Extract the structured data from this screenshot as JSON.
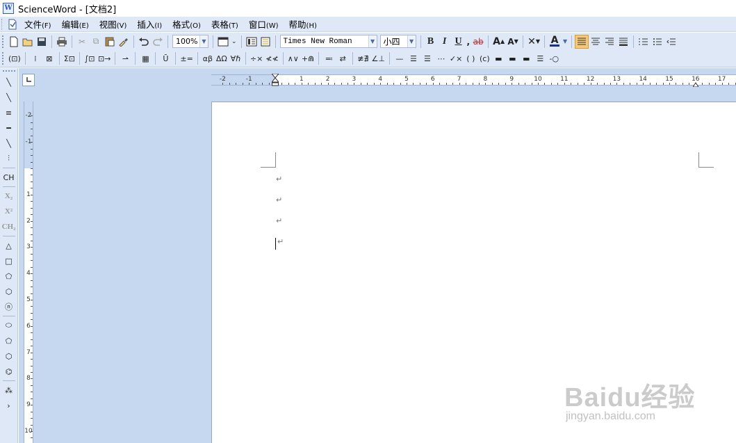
{
  "window": {
    "title": "ScienceWord - [文档2]"
  },
  "menu": [
    {
      "label": "文件",
      "accel": "(F)"
    },
    {
      "label": "编辑",
      "accel": "(E)"
    },
    {
      "label": "视图",
      "accel": "(V)"
    },
    {
      "label": "插入",
      "accel": "(I)"
    },
    {
      "label": "格式",
      "accel": "(O)"
    },
    {
      "label": "表格",
      "accel": "(T)"
    },
    {
      "label": "窗口",
      "accel": "(W)"
    },
    {
      "label": "帮助",
      "accel": "(H)"
    }
  ],
  "toolbar": {
    "zoom": "100%",
    "font_name": "Times New Roman",
    "font_size": "小四",
    "bold": "B",
    "italic": "I",
    "underline": "U",
    "strike": "ab",
    "grow_font": "A",
    "shrink_font": "A",
    "font_color": "A"
  },
  "toolbar2": {
    "items": [
      "(⊡)",
      "⁞",
      "⊠",
      "Σ⊡",
      "∫⊡",
      "⊡→",
      "⇀",
      "▦",
      "Ū",
      "±=",
      "αβ",
      "ΔΩ",
      "∀ℏ",
      "÷×",
      "≮≮",
      "∧∨",
      "+⋒",
      "≕",
      "⇄",
      "≢∄",
      "∠⊥",
      "—",
      "☰",
      "☰",
      "⋯",
      "✓×",
      "( )",
      "(c)",
      "▬",
      "▬",
      "▬",
      "☰",
      "-○"
    ]
  },
  "left_tools": [
    "╲",
    "╲",
    "≡",
    "━",
    "╲",
    "⫶",
    "CH",
    "X₂",
    "X²",
    "CH₂",
    "△",
    "□",
    "⬠",
    "⬡",
    "ⓝ",
    "⬭",
    "⬠",
    "⬡",
    "⌬",
    "⁂",
    "›"
  ],
  "ruler": {
    "h_numbers": [
      "-2",
      "-1",
      "1",
      "2",
      "3",
      "4",
      "5",
      "6",
      "7",
      "8",
      "9",
      "10",
      "11",
      "12",
      "13",
      "14",
      "15",
      "16",
      "17"
    ],
    "v_numbers": [
      "-2",
      "-1",
      "1",
      "2",
      "3",
      "4",
      "5",
      "6",
      "7",
      "8",
      "9",
      "10"
    ]
  },
  "document": {
    "paragraph_mark": "↵",
    "paragraph_count": 4
  },
  "watermark": {
    "logo": "Baidu经验",
    "url": "jingyan.baidu.com"
  }
}
